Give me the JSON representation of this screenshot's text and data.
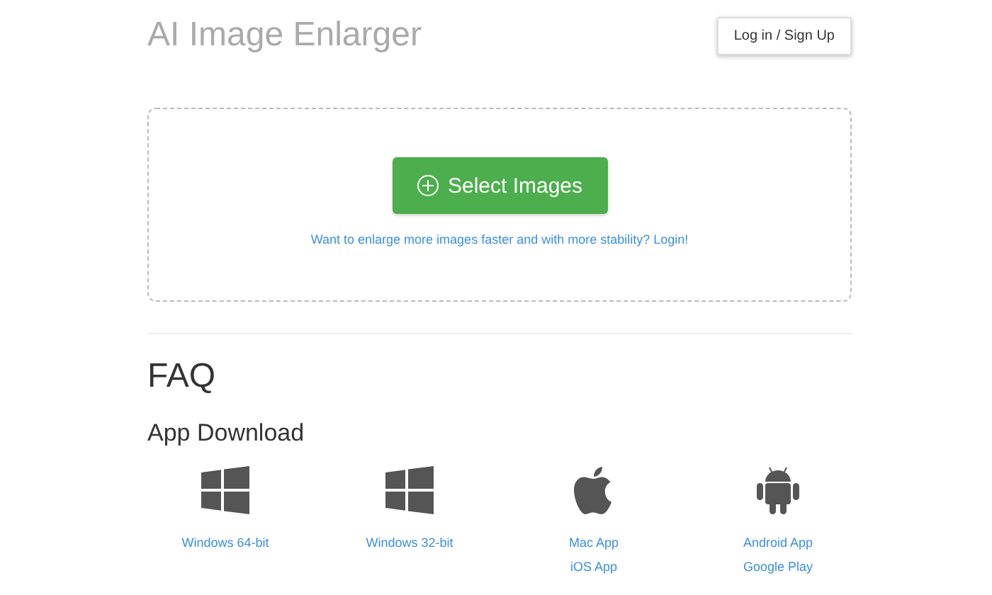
{
  "header": {
    "title": "AI Image Enlarger",
    "login_button": "Log in / Sign Up"
  },
  "upload": {
    "button": "Select Images",
    "hint": "Want to enlarge more images faster and with more stability? Login!"
  },
  "faq": {
    "title": "FAQ"
  },
  "app_download": {
    "title": "App Download",
    "items": [
      {
        "kind": "windows",
        "links": [
          "Windows 64-bit"
        ]
      },
      {
        "kind": "windows",
        "links": [
          "Windows 32-bit"
        ]
      },
      {
        "kind": "apple",
        "links": [
          "Mac App",
          "iOS App"
        ]
      },
      {
        "kind": "android",
        "links": [
          "Android App",
          "Google Play"
        ]
      }
    ]
  }
}
